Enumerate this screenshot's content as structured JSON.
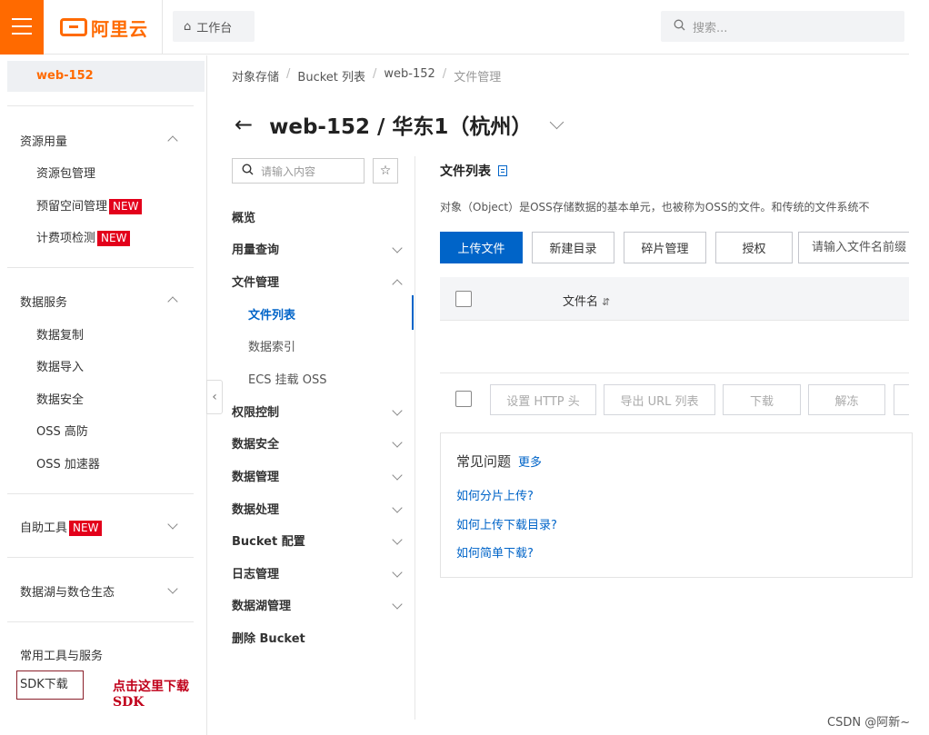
{
  "topbar": {
    "logo_text": "阿里云",
    "workbench_label": "工作台",
    "search_placeholder": "搜索..."
  },
  "sidebar": {
    "selected": "web-152",
    "groups": [
      {
        "label": "资源用量",
        "expanded": true,
        "items": [
          {
            "label": "资源包管理",
            "badge": ""
          },
          {
            "label": "预留空间管理",
            "badge": "NEW"
          },
          {
            "label": "计费项检测",
            "badge": "NEW"
          }
        ]
      },
      {
        "label": "数据服务",
        "expanded": true,
        "items": [
          {
            "label": "数据复制"
          },
          {
            "label": "数据导入"
          },
          {
            "label": "数据安全"
          },
          {
            "label": "OSS 高防"
          },
          {
            "label": "OSS 加速器"
          }
        ]
      },
      {
        "label": "自助工具",
        "badge": "NEW",
        "expanded": false
      },
      {
        "label": "数据湖与数仓生态",
        "expanded": false
      },
      {
        "label": "常用工具与服务",
        "items": [
          {
            "label": "SDK下载"
          }
        ]
      }
    ],
    "annotation": "点击这里下载SDK"
  },
  "breadcrumb": [
    "对象存储",
    "Bucket 列表",
    "web-152",
    "文件管理"
  ],
  "page_title": "web-152 / 华东1（杭州）",
  "subnav": {
    "search_placeholder": "请输入内容",
    "items": [
      {
        "label": "概览"
      },
      {
        "label": "用量查询"
      },
      {
        "label": "文件管理",
        "children": [
          "文件列表",
          "数据索引",
          "ECS 挂载 OSS"
        ]
      },
      {
        "label": "权限控制"
      },
      {
        "label": "数据安全"
      },
      {
        "label": "数据管理"
      },
      {
        "label": "数据处理"
      },
      {
        "label": "Bucket 配置"
      },
      {
        "label": "日志管理"
      },
      {
        "label": "数据湖管理"
      },
      {
        "label": "删除 Bucket"
      }
    ]
  },
  "content": {
    "title": "文件列表",
    "description": "对象（Object）是OSS存储数据的基本单元，也被称为OSS的文件。和传统的文件系统不",
    "buttons": [
      "上传文件",
      "新建目录",
      "碎片管理",
      "授权"
    ],
    "prefix_placeholder": "请输入文件名前缀",
    "table_header_name": "文件名",
    "batch_buttons": [
      "设置 HTTP 头",
      "导出 URL 列表",
      "下载",
      "解冻"
    ],
    "faq": {
      "title": "常见问题",
      "more": "更多",
      "links": [
        "如何分片上传?",
        "如何上传下载目录?",
        "如何简单下载?"
      ]
    }
  },
  "watermark": "CSDN @阿新~"
}
